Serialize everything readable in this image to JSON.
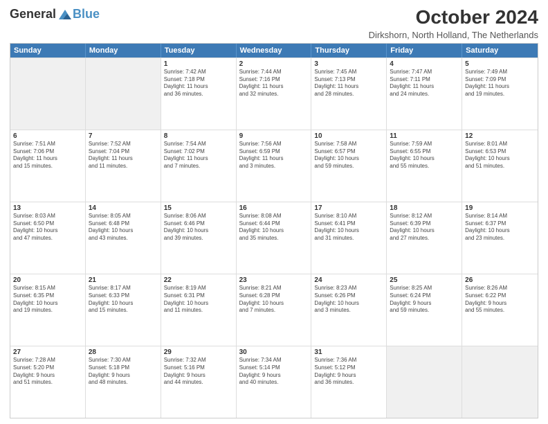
{
  "logo": {
    "general": "General",
    "blue": "Blue"
  },
  "title": "October 2024",
  "location": "Dirkshorn, North Holland, The Netherlands",
  "days": [
    "Sunday",
    "Monday",
    "Tuesday",
    "Wednesday",
    "Thursday",
    "Friday",
    "Saturday"
  ],
  "rows": [
    [
      {
        "day": "",
        "lines": []
      },
      {
        "day": "",
        "lines": []
      },
      {
        "day": "1",
        "lines": [
          "Sunrise: 7:42 AM",
          "Sunset: 7:18 PM",
          "Daylight: 11 hours",
          "and 36 minutes."
        ]
      },
      {
        "day": "2",
        "lines": [
          "Sunrise: 7:44 AM",
          "Sunset: 7:16 PM",
          "Daylight: 11 hours",
          "and 32 minutes."
        ]
      },
      {
        "day": "3",
        "lines": [
          "Sunrise: 7:45 AM",
          "Sunset: 7:13 PM",
          "Daylight: 11 hours",
          "and 28 minutes."
        ]
      },
      {
        "day": "4",
        "lines": [
          "Sunrise: 7:47 AM",
          "Sunset: 7:11 PM",
          "Daylight: 11 hours",
          "and 24 minutes."
        ]
      },
      {
        "day": "5",
        "lines": [
          "Sunrise: 7:49 AM",
          "Sunset: 7:09 PM",
          "Daylight: 11 hours",
          "and 19 minutes."
        ]
      }
    ],
    [
      {
        "day": "6",
        "lines": [
          "Sunrise: 7:51 AM",
          "Sunset: 7:06 PM",
          "Daylight: 11 hours",
          "and 15 minutes."
        ]
      },
      {
        "day": "7",
        "lines": [
          "Sunrise: 7:52 AM",
          "Sunset: 7:04 PM",
          "Daylight: 11 hours",
          "and 11 minutes."
        ]
      },
      {
        "day": "8",
        "lines": [
          "Sunrise: 7:54 AM",
          "Sunset: 7:02 PM",
          "Daylight: 11 hours",
          "and 7 minutes."
        ]
      },
      {
        "day": "9",
        "lines": [
          "Sunrise: 7:56 AM",
          "Sunset: 6:59 PM",
          "Daylight: 11 hours",
          "and 3 minutes."
        ]
      },
      {
        "day": "10",
        "lines": [
          "Sunrise: 7:58 AM",
          "Sunset: 6:57 PM",
          "Daylight: 10 hours",
          "and 59 minutes."
        ]
      },
      {
        "day": "11",
        "lines": [
          "Sunrise: 7:59 AM",
          "Sunset: 6:55 PM",
          "Daylight: 10 hours",
          "and 55 minutes."
        ]
      },
      {
        "day": "12",
        "lines": [
          "Sunrise: 8:01 AM",
          "Sunset: 6:53 PM",
          "Daylight: 10 hours",
          "and 51 minutes."
        ]
      }
    ],
    [
      {
        "day": "13",
        "lines": [
          "Sunrise: 8:03 AM",
          "Sunset: 6:50 PM",
          "Daylight: 10 hours",
          "and 47 minutes."
        ]
      },
      {
        "day": "14",
        "lines": [
          "Sunrise: 8:05 AM",
          "Sunset: 6:48 PM",
          "Daylight: 10 hours",
          "and 43 minutes."
        ]
      },
      {
        "day": "15",
        "lines": [
          "Sunrise: 8:06 AM",
          "Sunset: 6:46 PM",
          "Daylight: 10 hours",
          "and 39 minutes."
        ]
      },
      {
        "day": "16",
        "lines": [
          "Sunrise: 8:08 AM",
          "Sunset: 6:44 PM",
          "Daylight: 10 hours",
          "and 35 minutes."
        ]
      },
      {
        "day": "17",
        "lines": [
          "Sunrise: 8:10 AM",
          "Sunset: 6:41 PM",
          "Daylight: 10 hours",
          "and 31 minutes."
        ]
      },
      {
        "day": "18",
        "lines": [
          "Sunrise: 8:12 AM",
          "Sunset: 6:39 PM",
          "Daylight: 10 hours",
          "and 27 minutes."
        ]
      },
      {
        "day": "19",
        "lines": [
          "Sunrise: 8:14 AM",
          "Sunset: 6:37 PM",
          "Daylight: 10 hours",
          "and 23 minutes."
        ]
      }
    ],
    [
      {
        "day": "20",
        "lines": [
          "Sunrise: 8:15 AM",
          "Sunset: 6:35 PM",
          "Daylight: 10 hours",
          "and 19 minutes."
        ]
      },
      {
        "day": "21",
        "lines": [
          "Sunrise: 8:17 AM",
          "Sunset: 6:33 PM",
          "Daylight: 10 hours",
          "and 15 minutes."
        ]
      },
      {
        "day": "22",
        "lines": [
          "Sunrise: 8:19 AM",
          "Sunset: 6:31 PM",
          "Daylight: 10 hours",
          "and 11 minutes."
        ]
      },
      {
        "day": "23",
        "lines": [
          "Sunrise: 8:21 AM",
          "Sunset: 6:28 PM",
          "Daylight: 10 hours",
          "and 7 minutes."
        ]
      },
      {
        "day": "24",
        "lines": [
          "Sunrise: 8:23 AM",
          "Sunset: 6:26 PM",
          "Daylight: 10 hours",
          "and 3 minutes."
        ]
      },
      {
        "day": "25",
        "lines": [
          "Sunrise: 8:25 AM",
          "Sunset: 6:24 PM",
          "Daylight: 9 hours",
          "and 59 minutes."
        ]
      },
      {
        "day": "26",
        "lines": [
          "Sunrise: 8:26 AM",
          "Sunset: 6:22 PM",
          "Daylight: 9 hours",
          "and 55 minutes."
        ]
      }
    ],
    [
      {
        "day": "27",
        "lines": [
          "Sunrise: 7:28 AM",
          "Sunset: 5:20 PM",
          "Daylight: 9 hours",
          "and 51 minutes."
        ]
      },
      {
        "day": "28",
        "lines": [
          "Sunrise: 7:30 AM",
          "Sunset: 5:18 PM",
          "Daylight: 9 hours",
          "and 48 minutes."
        ]
      },
      {
        "day": "29",
        "lines": [
          "Sunrise: 7:32 AM",
          "Sunset: 5:16 PM",
          "Daylight: 9 hours",
          "and 44 minutes."
        ]
      },
      {
        "day": "30",
        "lines": [
          "Sunrise: 7:34 AM",
          "Sunset: 5:14 PM",
          "Daylight: 9 hours",
          "and 40 minutes."
        ]
      },
      {
        "day": "31",
        "lines": [
          "Sunrise: 7:36 AM",
          "Sunset: 5:12 PM",
          "Daylight: 9 hours",
          "and 36 minutes."
        ]
      },
      {
        "day": "",
        "lines": []
      },
      {
        "day": "",
        "lines": []
      }
    ]
  ]
}
